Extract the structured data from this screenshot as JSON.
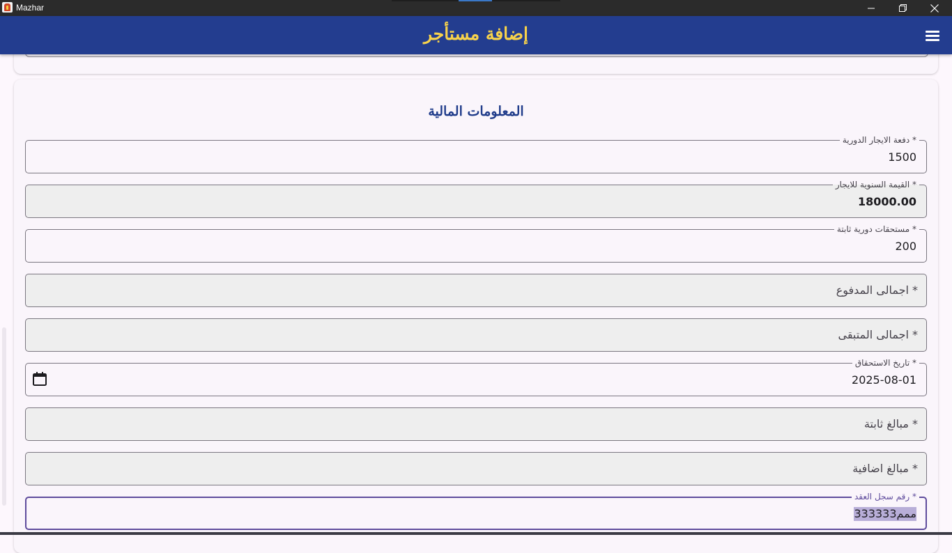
{
  "window": {
    "title": "Mazhar"
  },
  "appbar": {
    "title": "إضافة مستأجر",
    "menu_icon": "menu-icon"
  },
  "section": {
    "title": "المعلومات المالية"
  },
  "fields": {
    "periodic_rent": {
      "label": "دفعة الايجار الدورية *",
      "value": "1500"
    },
    "annual_rent": {
      "label": "القيمة السنوية للايجار *",
      "value": "18000.00"
    },
    "fixed_dues": {
      "label": "مستحقات دورية ثابتة *",
      "value": "200"
    },
    "total_paid": {
      "placeholder": "اجمالى المدفوع *"
    },
    "total_remaining": {
      "placeholder": "اجمالى المتبقى *"
    },
    "due_date": {
      "label": "تاريخ الاستحقاق *",
      "value": "2025-08-01",
      "icon": "calendar-icon"
    },
    "fixed_amounts": {
      "placeholder": "مبالغ ثابتة *"
    },
    "extra_amounts": {
      "placeholder": "مبالغ اضافية *"
    },
    "contract_number": {
      "label": "رقم سجل العقد *",
      "value": "333333ممم"
    }
  },
  "colors": {
    "appbar_bg": "#233d8f",
    "appbar_title": "#f7d24b",
    "section_title": "#1f3b8a",
    "focus": "#5e4b9c"
  }
}
